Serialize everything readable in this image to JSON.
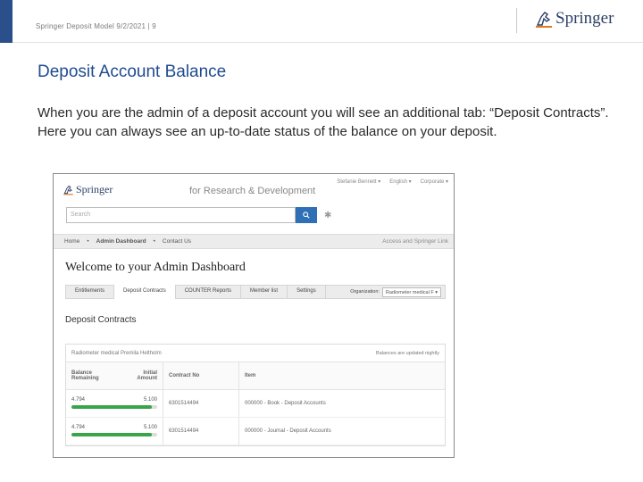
{
  "slide": {
    "footer": "Springer Deposit Model 9/2/2021 | 9",
    "logo_text": "Springer",
    "title": "Deposit Account Balance",
    "body": "When you are the admin of a deposit account you will see an additional tab: “Deposit Contracts”. Here you can always see an up-to-date status of the balance on your deposit."
  },
  "screenshot": {
    "logo_text": "Springer",
    "tagline": "for Research & Development",
    "user_links": [
      "Stefanie Bennett ▾",
      "English ▾",
      "Corporate ▾"
    ],
    "search_placeholder": "Search",
    "search_icon": "magnifier-icon",
    "settings_icon": "gear-icon",
    "breadcrumbs": [
      "Home",
      "Admin Dashboard",
      "Contact Us"
    ],
    "breadcrumb_right": "Access and Springer Link",
    "welcome": "Welcome to your Admin Dashboard",
    "tabs": [
      "Entitlements",
      "Deposit Contracts",
      "COUNTER Reports",
      "Member list",
      "Settings"
    ],
    "active_tab": "Deposit Contracts",
    "organization_label": "Organization:",
    "organization_value": "Radiometer medical F ▾",
    "section_title": "Deposit Contracts",
    "panel_org": "Radiometer medical Premila Heltholm",
    "panel_note": "Balances are updated nightly",
    "columns": {
      "balance": "Balance Remaining",
      "initial": "Initial Amount",
      "contract": "Contract No",
      "item": "Item"
    },
    "rows": [
      {
        "remaining": "4.794",
        "initial": "5.100",
        "fraction": 0.94,
        "contract": "6301514494",
        "item": "000000 - Book - Deposit Accounts"
      },
      {
        "remaining": "4.794",
        "initial": "5.100",
        "fraction": 0.94,
        "contract": "6301514494",
        "item": "000000 - Journal - Deposit Accounts"
      }
    ],
    "colors": {
      "accent": "#2f6fb5",
      "bar_fill": "#3aa449",
      "title": "#1f4b8f"
    }
  }
}
